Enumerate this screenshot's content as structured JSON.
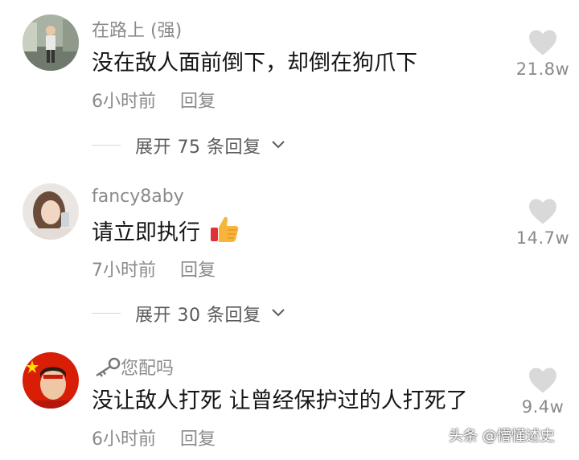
{
  "comments": [
    {
      "username": "在路上 (强)",
      "content": "没在敌人面前倒下，却倒在狗爪下",
      "time": "6小时前",
      "reply_label": "回复",
      "likes": "21.8w",
      "expand_label": "展开 75 条回复"
    },
    {
      "username": "fancy8aby",
      "content": "请立即执行",
      "emoji": "thumbs-up-icon",
      "time": "7小时前",
      "reply_label": "回复",
      "likes": "14.7w",
      "expand_label": "展开 30 条回复"
    },
    {
      "username": "您配吗",
      "username_icon": "key-icon",
      "content": "没让敌人打死 让曾经保护过的人打死了",
      "time": "6小时前",
      "reply_label": "回复",
      "likes": "9.4w"
    }
  ],
  "watermark": "头条 @懵懂述史",
  "colors": {
    "text": "#161616",
    "meta": "#8a8a8a",
    "heart": "#d9d9d9",
    "accent_flag": "#d81e06"
  }
}
